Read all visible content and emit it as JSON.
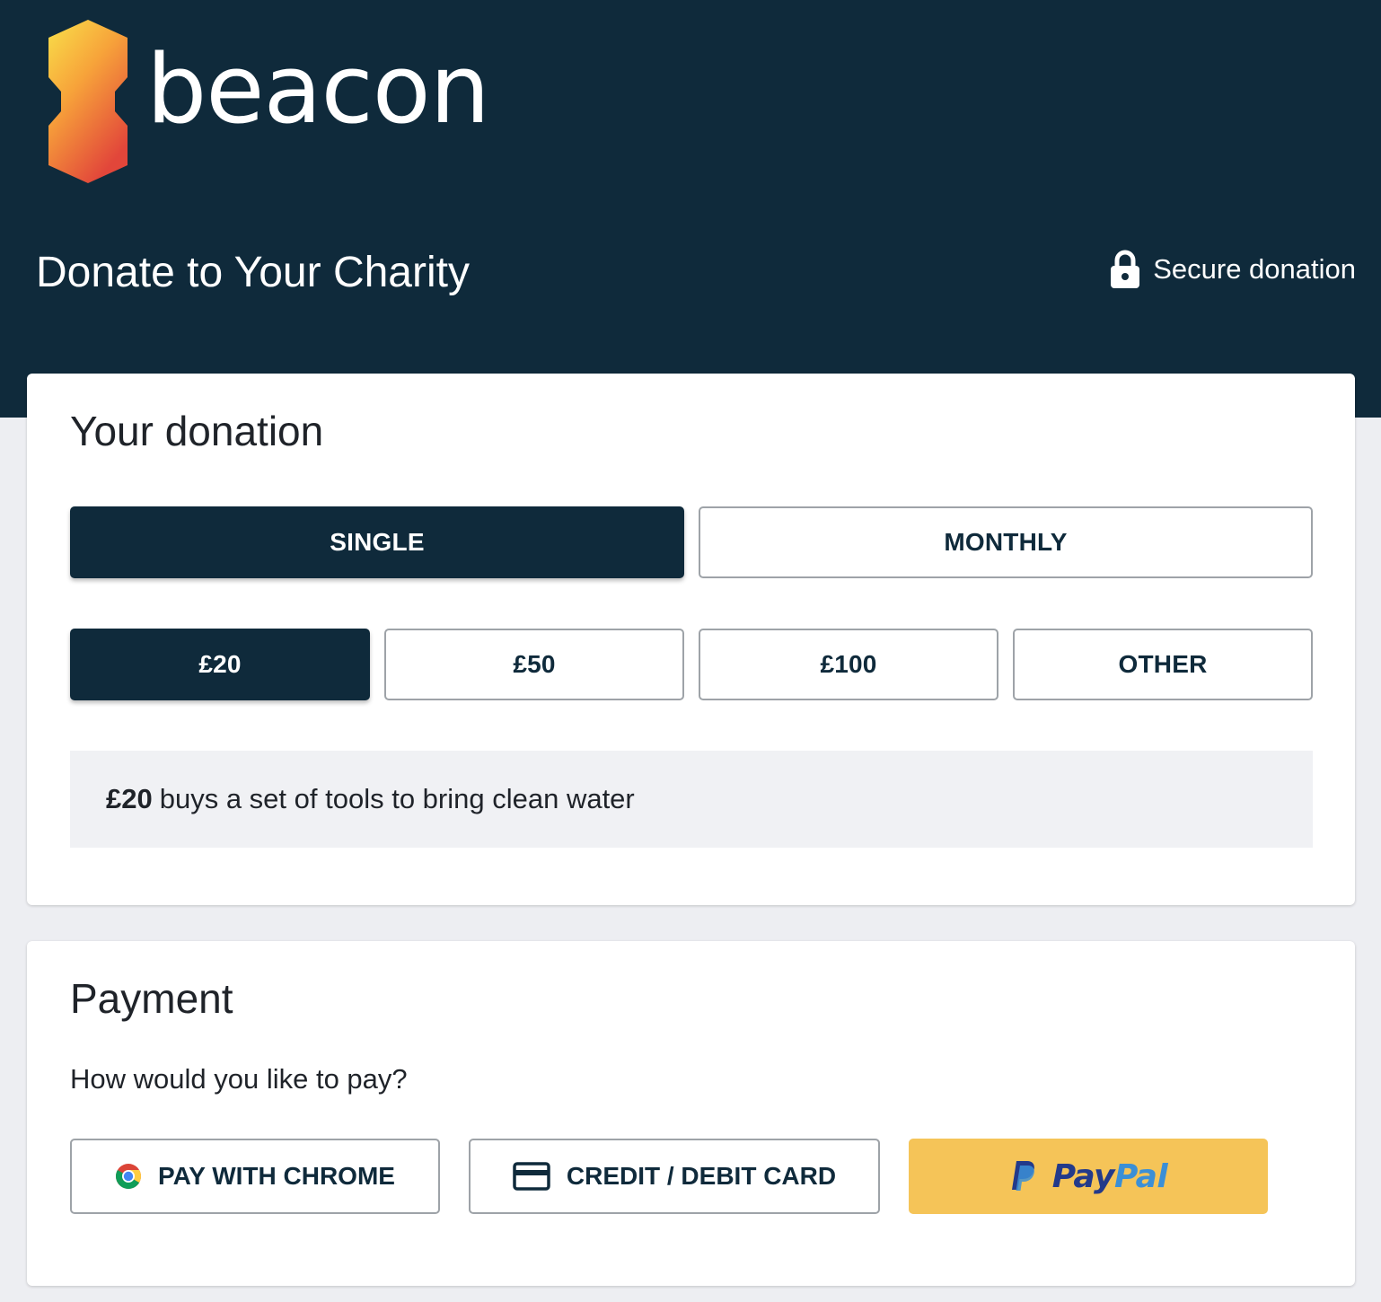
{
  "brand": {
    "name": "beacon",
    "colors": {
      "header_bg": "#0f2a3b",
      "page_bg": "#edeef2",
      "paypal_yellow": "#f5c458"
    }
  },
  "header": {
    "title": "Donate to Your Charity",
    "secure_label": "Secure donation",
    "secure_icon": "lock-icon"
  },
  "donation": {
    "title": "Your donation",
    "frequency": {
      "options": [
        "SINGLE",
        "MONTHLY"
      ],
      "selected": "SINGLE"
    },
    "amounts": {
      "options": [
        "£20",
        "£50",
        "£100",
        "OTHER"
      ],
      "selected": "£20"
    },
    "impact": {
      "amount": "£20",
      "text": "buys a set of tools to bring clean water"
    }
  },
  "payment": {
    "title": "Payment",
    "question": "How would you like to pay?",
    "methods": {
      "chrome": {
        "label": "PAY WITH CHROME",
        "icon": "chrome-icon"
      },
      "card": {
        "label": "CREDIT / DEBIT CARD",
        "icon": "credit-card-icon"
      },
      "paypal": {
        "label_part1": "Pay",
        "label_part2": "Pal",
        "icon": "paypal-icon"
      }
    }
  }
}
